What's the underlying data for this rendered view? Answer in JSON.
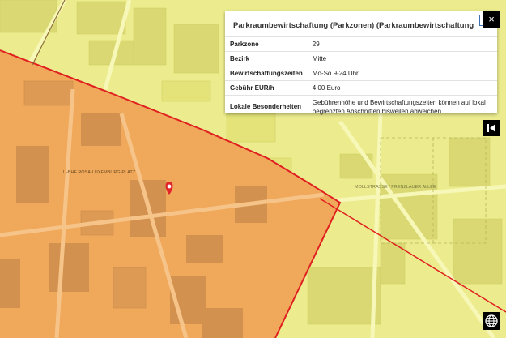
{
  "popup": {
    "title": "Parkraumbewirtschaftung (Parkzonen) (Parkraumbewirtschaftung (Parkzon",
    "close_label": "×",
    "rows": [
      {
        "key": "Parkzone",
        "value": "29"
      },
      {
        "key": "Bezirk",
        "value": "Mitte"
      },
      {
        "key": "Bewirtschaftungszeiten",
        "value": "Mo-So 9-24 Uhr"
      },
      {
        "key": "Gebühr EUR/h",
        "value": "4,00 Euro"
      },
      {
        "key": "Lokale Besonderheiten",
        "value": "Gebührenhöhe und Bewirtschaftungszeiten können auf lokal begrenzten Abschnitten bisweilen abweichen"
      }
    ]
  },
  "map": {
    "zone_fill_color": "#f0a85a",
    "outside_fill_color": "#ecec8e",
    "zone_border_color": "#e02020",
    "marker_color": "#e0262b",
    "labels": {
      "place": "U-BHF ROSA-LUXEMBURG-PLATZ",
      "park": "MOLLSTRASSE / PRENZLAUER ALLEE"
    }
  },
  "controls": {
    "side_close_icon": "close-icon",
    "side_close_label": "×",
    "back_icon": "skip-back-icon",
    "globe_icon": "globe-icon"
  }
}
